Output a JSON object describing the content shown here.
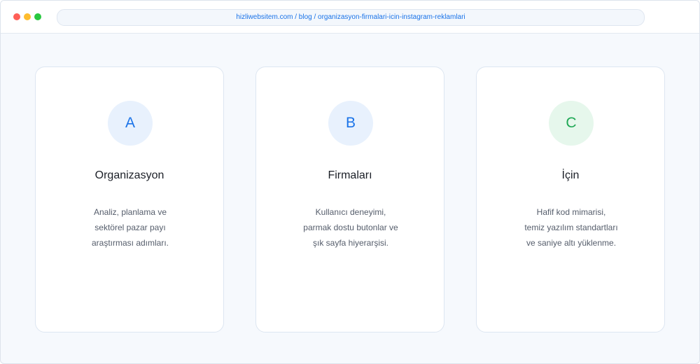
{
  "browser": {
    "url": "hizliwebsitem.com / blog / organizasyon-firmalari-icin-instagram-reklamlari",
    "controls": [
      {
        "name": "close",
        "color": "#ff5f57"
      },
      {
        "name": "minimize",
        "color": "#febc2e"
      },
      {
        "name": "maximize",
        "color": "#28c840"
      }
    ]
  },
  "cards": [
    {
      "letter": "A",
      "title": "Organizasyon",
      "lines": [
        "Analiz, planlama ve",
        "sektörel pazar payı",
        "araştırması adımları."
      ],
      "accent": "#1a73e8",
      "badge_bg": "#e8f1fd"
    },
    {
      "letter": "B",
      "title": "Firmaları",
      "lines": [
        "Kullanıcı deneyimi,",
        "parmak dostu butonlar ve",
        "şık sayfa hiyerarşisi."
      ],
      "accent": "#1a73e8",
      "badge_bg": "#e8f1fd"
    },
    {
      "letter": "C",
      "title": "İçin",
      "lines": [
        "Hafif kod mimarisi,",
        "temiz yazılım standartları",
        "ve saniye altı yüklenme."
      ],
      "accent": "#1fa855",
      "badge_bg": "#e6f7ec"
    }
  ]
}
